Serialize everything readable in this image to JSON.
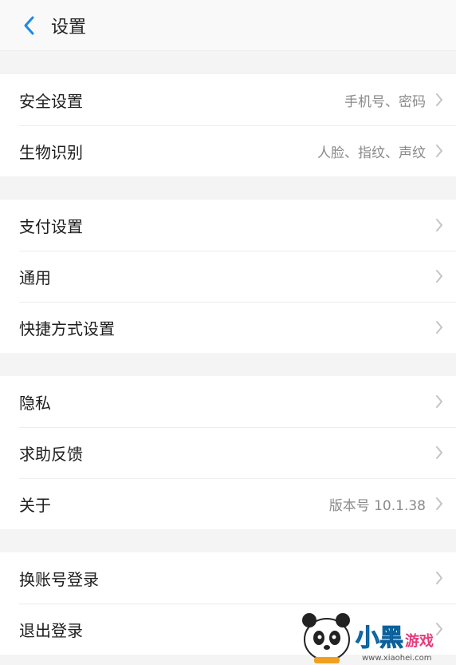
{
  "header": {
    "title": "设置",
    "back_icon": "chevron-left-icon"
  },
  "colors": {
    "accent": "#1e88e5",
    "value_text": "#8a8a8a"
  },
  "groups": [
    {
      "items": [
        {
          "label": "安全设置",
          "value": "手机号、密码"
        },
        {
          "label": "生物识别",
          "value": "人脸、指纹、声纹"
        }
      ]
    },
    {
      "items": [
        {
          "label": "支付设置",
          "value": ""
        },
        {
          "label": "通用",
          "value": ""
        },
        {
          "label": "快捷方式设置",
          "value": ""
        }
      ]
    },
    {
      "items": [
        {
          "label": "隐私",
          "value": ""
        },
        {
          "label": "求助反馈",
          "value": ""
        },
        {
          "label": "关于",
          "value": "版本号 10.1.38"
        }
      ]
    },
    {
      "items": [
        {
          "label": "换账号登录",
          "value": ""
        },
        {
          "label": "退出登录",
          "value": ""
        }
      ]
    }
  ],
  "watermark": {
    "brand": "小黑游戏",
    "url": "www.xiaohei.com"
  }
}
